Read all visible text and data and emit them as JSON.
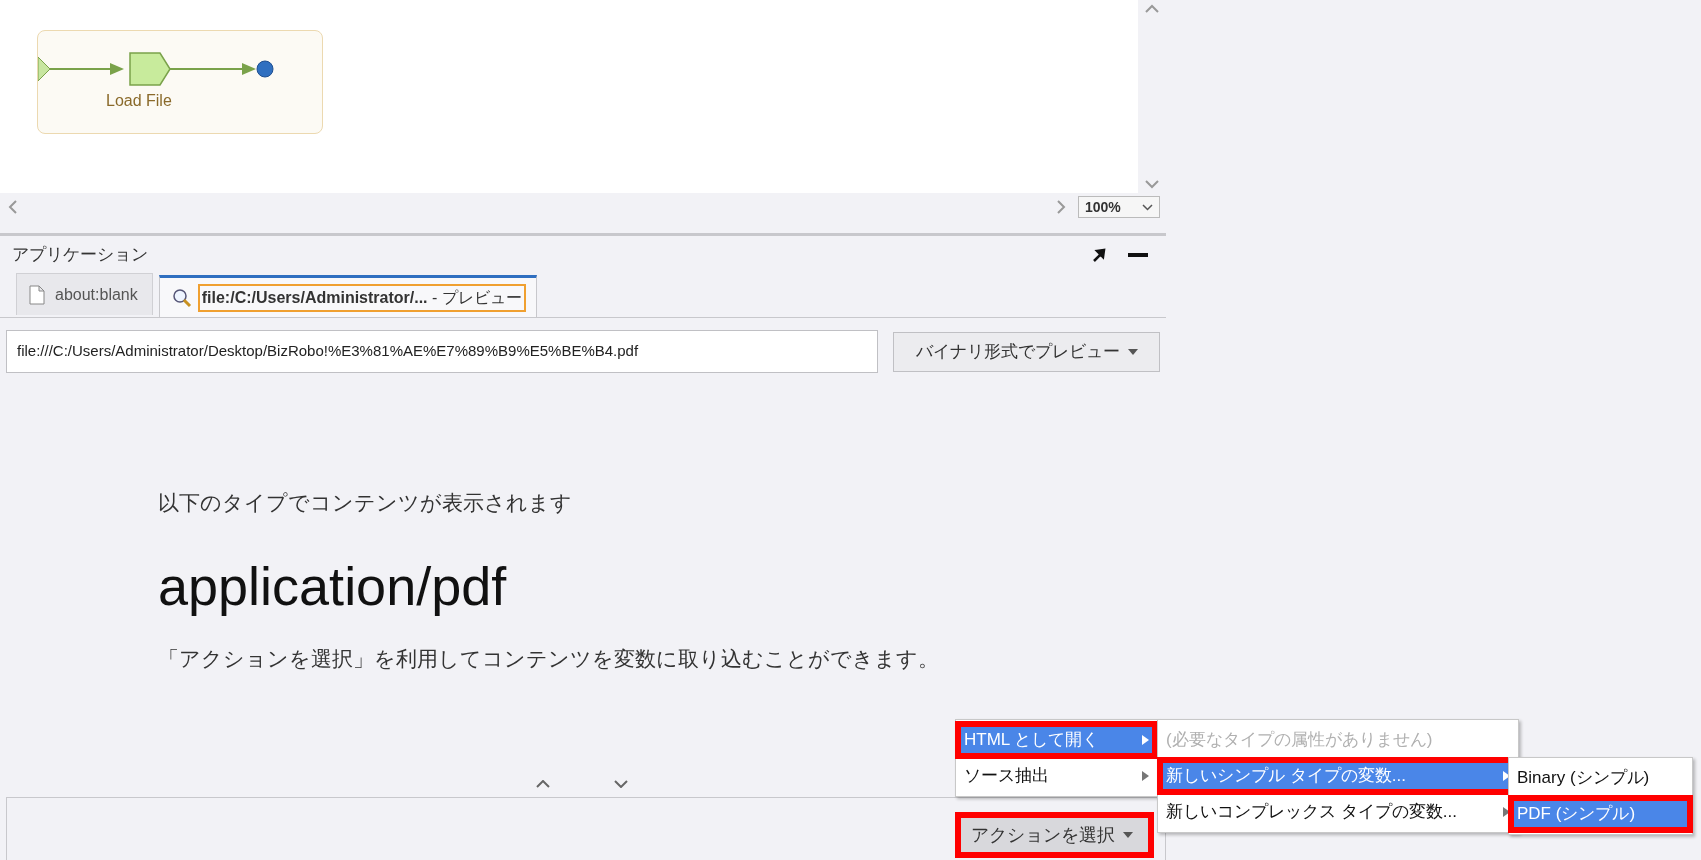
{
  "canvas": {
    "node_label": "Load File"
  },
  "zoom": {
    "value": "100%"
  },
  "panel": {
    "title": "アプリケーション"
  },
  "tabs": [
    {
      "label": "about:blank",
      "selected": false,
      "focused": false,
      "kind": "page"
    },
    {
      "label": "file:/C:/Users/Administrator/...",
      "suffix": "- プレビュー",
      "selected": true,
      "focused": true,
      "kind": "preview"
    }
  ],
  "url": {
    "value": "file:///C:/Users/Administrator/Desktop/BizRobo!%E3%81%AE%E7%89%B9%E5%BE%B4.pdf"
  },
  "preview_button": {
    "label": "バイナリ形式でプレビュー"
  },
  "content": {
    "intro": "以下のタイプでコンテンツが表示されます",
    "mime": "application/pdf",
    "hint": "「アクションを選択」を利用してコンテンツを変数に取り込むことができます。"
  },
  "action_button": {
    "label": "アクションを選択",
    "highlighted": true
  },
  "action_menu": [
    {
      "label": "HTML として開く",
      "selected": true,
      "highlighted": true,
      "disabled": false,
      "submenu": true
    },
    {
      "label": "ソース抽出",
      "selected": false,
      "highlighted": false,
      "disabled": false,
      "submenu": true
    }
  ],
  "submenu": [
    {
      "label": "(必要なタイプの属性がありません)",
      "selected": false,
      "highlighted": false,
      "disabled": true,
      "submenu": false
    },
    {
      "label": "新しいシンプル タイプの変数...",
      "selected": true,
      "highlighted": true,
      "disabled": false,
      "submenu": true
    },
    {
      "label": "新しいコンプレックス タイプの変数...",
      "selected": false,
      "highlighted": false,
      "disabled": false,
      "submenu": true
    }
  ],
  "type_menu": [
    {
      "label": "Binary (シンプル)",
      "selected": false,
      "highlighted": false,
      "disabled": false,
      "submenu": false
    },
    {
      "label": "PDF (シンプル)",
      "selected": true,
      "highlighted": true,
      "disabled": false,
      "submenu": false
    }
  ]
}
